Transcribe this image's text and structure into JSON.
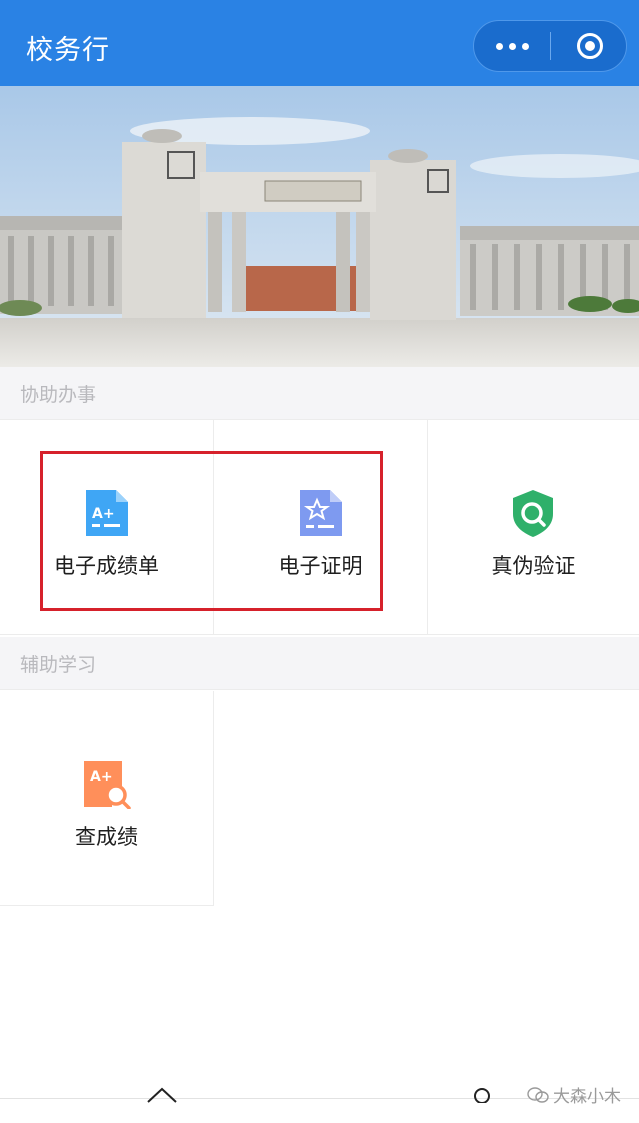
{
  "header": {
    "title": "校务行",
    "more_icon": "more-dots-icon",
    "close_icon": "target-icon",
    "background": "#2a82e4"
  },
  "sections": [
    {
      "title": "协助办事",
      "items": [
        {
          "label": "电子成绩单",
          "icon": "grade-sheet-icon",
          "color": "#3fa6f5"
        },
        {
          "label": "电子证明",
          "icon": "certificate-star-icon",
          "color": "#7e9af0"
        },
        {
          "label": "真伪验证",
          "icon": "shield-search-icon",
          "color": "#2fb06a"
        }
      ]
    },
    {
      "title": "辅助学习",
      "items": [
        {
          "label": "查成绩",
          "icon": "grade-search-icon",
          "color": "#ff8f5a"
        }
      ]
    }
  ],
  "watermark": "大森小木",
  "accent_highlight": "#d6212b"
}
